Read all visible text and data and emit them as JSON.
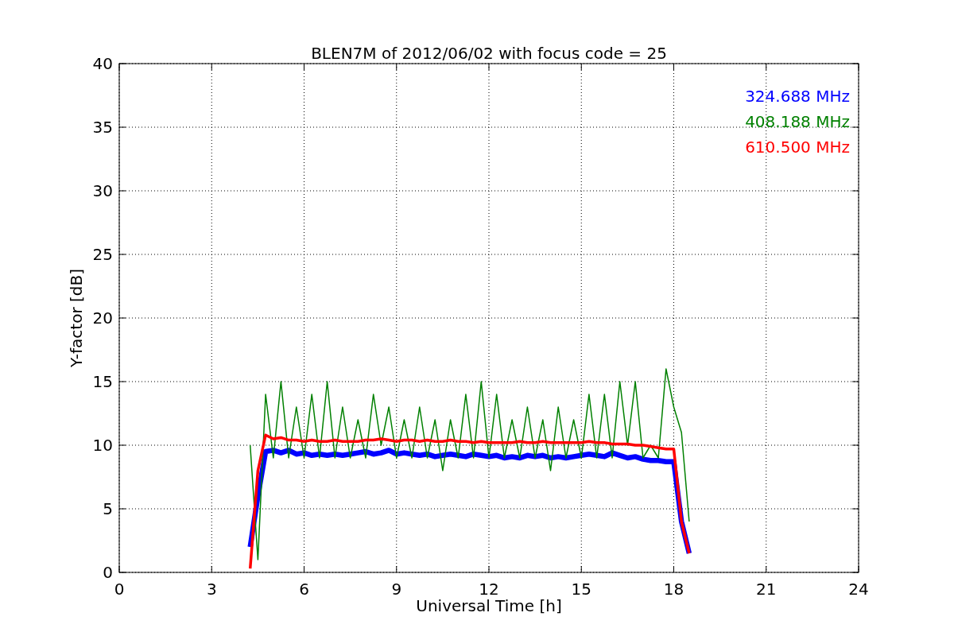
{
  "chart_data": {
    "type": "line",
    "title": "BLEN7M of 2012/06/02 with focus code = 25",
    "xlabel": "Universal Time [h]",
    "ylabel": "Y-factor [dB]",
    "x": [
      4.25,
      4.5,
      4.75,
      5,
      5.25,
      5.5,
      5.75,
      6,
      6.25,
      6.5,
      6.75,
      7,
      7.25,
      7.5,
      7.75,
      8,
      8.25,
      8.5,
      8.75,
      9,
      9.25,
      9.5,
      9.75,
      10,
      10.25,
      10.5,
      10.75,
      11,
      11.25,
      11.5,
      11.75,
      12,
      12.25,
      12.5,
      12.75,
      13,
      13.25,
      13.5,
      13.75,
      14,
      14.25,
      14.5,
      14.75,
      15,
      15.25,
      15.5,
      15.75,
      16,
      16.25,
      16.5,
      16.75,
      17,
      17.25,
      17.5,
      17.75,
      18,
      18.25,
      18.5
    ],
    "series": [
      {
        "name": "324.688 MHz",
        "color": "#0000ff",
        "values": [
          2,
          6,
          9.5,
          9.6,
          9.4,
          9.6,
          9.3,
          9.4,
          9.2,
          9.3,
          9.2,
          9.3,
          9.2,
          9.3,
          9.4,
          9.5,
          9.3,
          9.4,
          9.6,
          9.3,
          9.4,
          9.3,
          9.2,
          9.3,
          9.1,
          9.2,
          9.3,
          9.2,
          9.1,
          9.3,
          9.2,
          9.1,
          9.2,
          9,
          9.1,
          9,
          9.2,
          9.1,
          9.2,
          9,
          9.1,
          9,
          9.1,
          9.2,
          9.3,
          9.2,
          9.1,
          9.4,
          9.2,
          9,
          9.1,
          8.9,
          8.8,
          8.8,
          8.7,
          8.7,
          4,
          1.5
        ]
      },
      {
        "name": "408.188 MHz",
        "color": "#008000",
        "values": [
          10,
          1,
          14,
          9,
          15,
          9,
          13,
          9,
          14,
          9,
          15,
          9,
          13,
          9,
          12,
          9,
          14,
          10,
          13,
          9,
          12,
          9,
          13,
          9,
          12,
          8,
          12,
          9,
          14,
          9,
          15,
          9,
          14,
          9,
          12,
          9,
          13,
          9,
          12,
          8,
          13,
          9,
          12,
          9,
          14,
          9,
          14,
          9,
          15,
          10,
          15,
          9,
          10,
          9,
          16,
          13,
          11,
          4
        ]
      },
      {
        "name": "610.500 MHz",
        "color": "#ff0000",
        "values": [
          0.3,
          8,
          10.8,
          10.5,
          10.6,
          10.4,
          10.4,
          10.3,
          10.4,
          10.3,
          10.3,
          10.4,
          10.3,
          10.3,
          10.3,
          10.4,
          10.4,
          10.5,
          10.4,
          10.3,
          10.4,
          10.4,
          10.3,
          10.4,
          10.3,
          10.3,
          10.4,
          10.3,
          10.3,
          10.2,
          10.3,
          10.2,
          10.2,
          10.2,
          10.2,
          10.3,
          10.2,
          10.2,
          10.3,
          10.2,
          10.2,
          10.2,
          10.2,
          10.2,
          10.3,
          10.2,
          10.2,
          10.1,
          10.1,
          10.1,
          10,
          10,
          9.9,
          9.8,
          9.7,
          9.7,
          4,
          1.5
        ]
      }
    ],
    "xlim": [
      0,
      24
    ],
    "ylim": [
      0,
      40
    ],
    "xticks": [
      0,
      3,
      6,
      9,
      12,
      15,
      18,
      21,
      24
    ],
    "yticks": [
      0,
      5,
      10,
      15,
      20,
      25,
      30,
      35,
      40
    ],
    "grid": true
  }
}
